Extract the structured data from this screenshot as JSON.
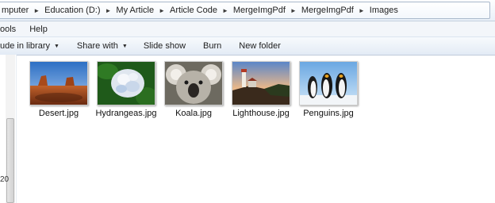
{
  "breadcrumb": [
    "mputer",
    "Education (D:)",
    "My Article",
    "Article Code",
    "MergeImgPdf",
    "MergeImgPdf",
    "Images"
  ],
  "menu": {
    "tools": "ools",
    "help": "Help"
  },
  "toolbar": {
    "include_library": "ude in library",
    "share_with": "Share with",
    "slide_show": "Slide show",
    "burn": "Burn",
    "new_folder": "New folder"
  },
  "nav_pane": {
    "partial_text": "20"
  },
  "files": [
    {
      "name": "Desert.jpg",
      "icon": "desert-thumbnail"
    },
    {
      "name": "Hydrangeas.jpg",
      "icon": "hydrangeas-thumbnail"
    },
    {
      "name": "Koala.jpg",
      "icon": "koala-thumbnail"
    },
    {
      "name": "Lighthouse.jpg",
      "icon": "lighthouse-thumbnail"
    },
    {
      "name": "Penguins.jpg",
      "icon": "penguins-thumbnail"
    }
  ],
  "colors": {
    "toolbar_top": "#f7fafd",
    "toolbar_bottom": "#e3ebf5",
    "border": "#bfcbdb"
  }
}
